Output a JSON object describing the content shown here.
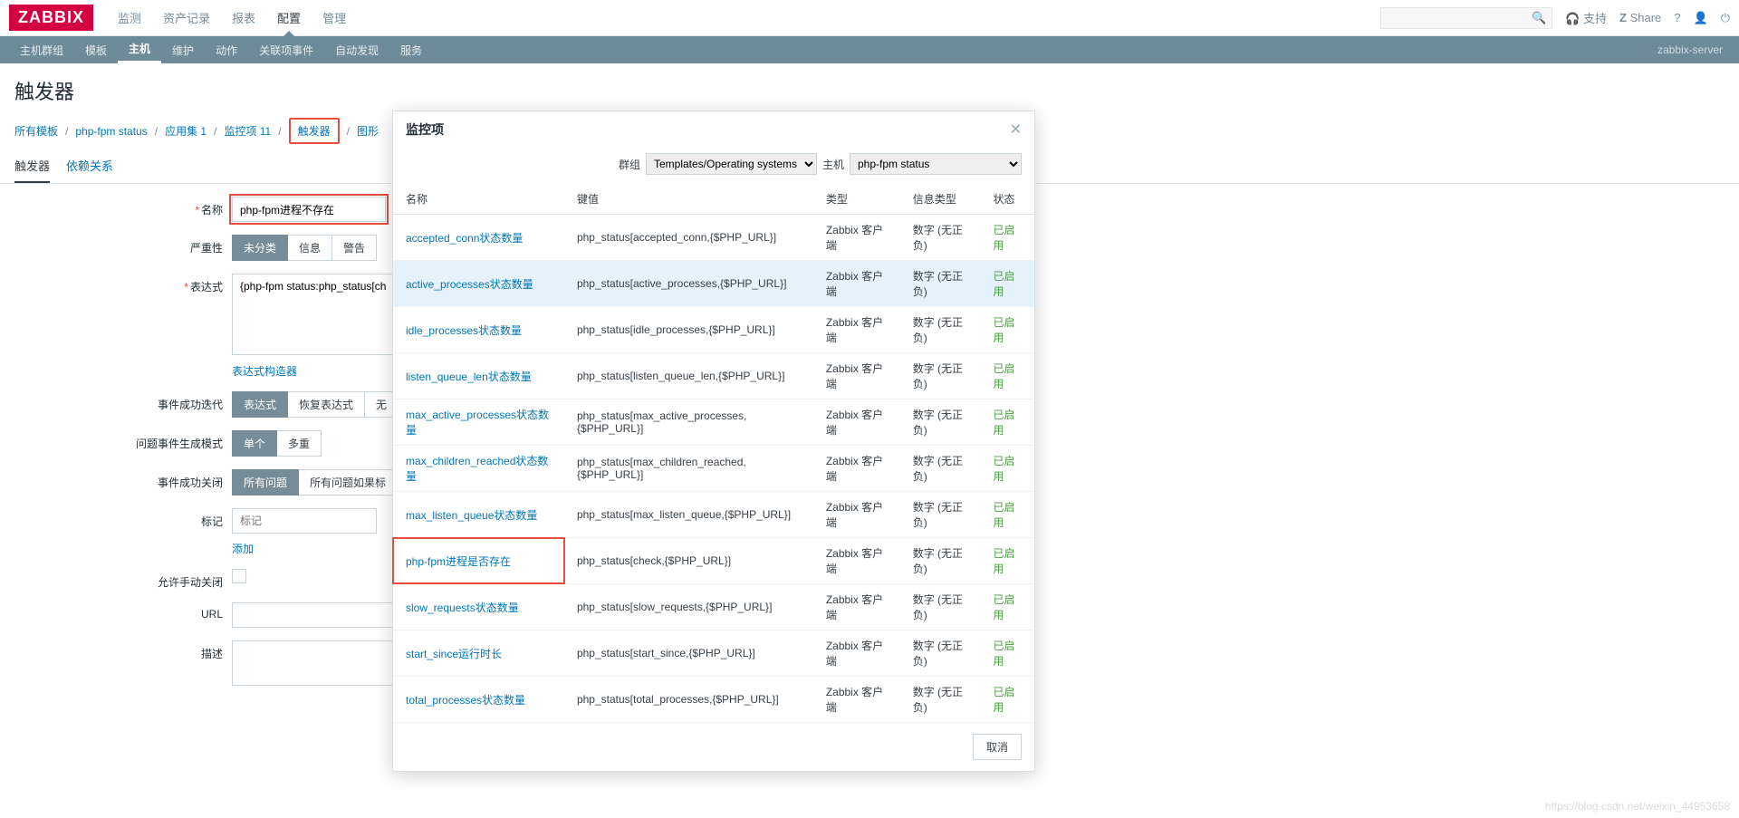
{
  "brand": "ZABBIX",
  "topnav": [
    "监测",
    "资产记录",
    "报表",
    "配置",
    "管理"
  ],
  "topnav_active": 3,
  "top_right": {
    "support": "支持",
    "share": "Share"
  },
  "subnav": [
    "主机群组",
    "模板",
    "主机",
    "维护",
    "动作",
    "关联项事件",
    "自动发现",
    "服务"
  ],
  "subnav_active": 2,
  "subnav_right": "zabbix-server",
  "page_title": "触发器",
  "breadcrumb": [
    {
      "text": "所有模板",
      "link": true
    },
    {
      "text": "php-fpm status",
      "link": true
    },
    {
      "text": "应用集 1",
      "link": true
    },
    {
      "text": "监控项 11",
      "link": true
    },
    {
      "text": "触发器",
      "link": true,
      "outlined": true
    },
    {
      "text": "图形",
      "link": true
    }
  ],
  "tabs": [
    "触发器",
    "依赖关系"
  ],
  "tabs_active": 0,
  "form": {
    "name_label": "名称",
    "name_value": "php-fpm进程不存在",
    "severity_label": "严重性",
    "severity_opts": [
      "未分类",
      "信息",
      "警告"
    ],
    "expression_label": "表达式",
    "expression_value": "{php-fpm status:php_status[ch",
    "expression_builder": "表达式构造器",
    "ok_event_label": "事件成功迭代",
    "ok_event_opts": [
      "表达式",
      "恢复表达式",
      "无"
    ],
    "problem_mode_label": "问题事件生成模式",
    "problem_mode_opts": [
      "单个",
      "多重"
    ],
    "ok_close_label": "事件成功关闭",
    "ok_close_opts": [
      "所有问题",
      "所有问题如果标"
    ],
    "tags_label": "标记",
    "tags_placeholder": "标记",
    "tags_add": "添加",
    "manual_close_label": "允许手动关闭",
    "url_label": "URL",
    "desc_label": "描述"
  },
  "modal": {
    "title": "监控项",
    "group_label": "群组",
    "group_value": "Templates/Operating systems",
    "host_label": "主机",
    "host_value": "php-fpm status",
    "cols": [
      "名称",
      "键值",
      "类型",
      "信息类型",
      "状态"
    ],
    "rows": [
      {
        "name": "accepted_conn状态数量",
        "key": "php_status[accepted_conn,{$PHP_URL}]",
        "type": "Zabbix 客户端",
        "info": "数字 (无正负)",
        "status": "已启用"
      },
      {
        "name": "active_processes状态数量",
        "key": "php_status[active_processes,{$PHP_URL}]",
        "type": "Zabbix 客户端",
        "info": "数字 (无正负)",
        "status": "已启用",
        "highlight": true
      },
      {
        "name": "idle_processes状态数量",
        "key": "php_status[idle_processes,{$PHP_URL}]",
        "type": "Zabbix 客户端",
        "info": "数字 (无正负)",
        "status": "已启用"
      },
      {
        "name": "listen_queue_len状态数量",
        "key": "php_status[listen_queue_len,{$PHP_URL}]",
        "type": "Zabbix 客户端",
        "info": "数字 (无正负)",
        "status": "已启用"
      },
      {
        "name": "max_active_processes状态数量",
        "key": "php_status[max_active_processes,{$PHP_URL}]",
        "type": "Zabbix 客户端",
        "info": "数字 (无正负)",
        "status": "已启用"
      },
      {
        "name": "max_children_reached状态数量",
        "key": "php_status[max_children_reached,{$PHP_URL}]",
        "type": "Zabbix 客户端",
        "info": "数字 (无正负)",
        "status": "已启用"
      },
      {
        "name": "max_listen_queue状态数量",
        "key": "php_status[max_listen_queue,{$PHP_URL}]",
        "type": "Zabbix 客户端",
        "info": "数字 (无正负)",
        "status": "已启用"
      },
      {
        "name": "php-fpm进程是否存在",
        "key": "php_status[check,{$PHP_URL}]",
        "type": "Zabbix 客户端",
        "info": "数字 (无正负)",
        "status": "已启用",
        "red": true
      },
      {
        "name": "slow_requests状态数量",
        "key": "php_status[slow_requests,{$PHP_URL}]",
        "type": "Zabbix 客户端",
        "info": "数字 (无正负)",
        "status": "已启用"
      },
      {
        "name": "start_since运行时长",
        "key": "php_status[start_since,{$PHP_URL}]",
        "type": "Zabbix 客户端",
        "info": "数字 (无正负)",
        "status": "已启用"
      },
      {
        "name": "total_processes状态数量",
        "key": "php_status[total_processes,{$PHP_URL}]",
        "type": "Zabbix 客户端",
        "info": "数字 (无正负)",
        "status": "已启用"
      }
    ],
    "cancel": "取消"
  },
  "watermark": "https://blog.csdn.net/weixin_44953658"
}
